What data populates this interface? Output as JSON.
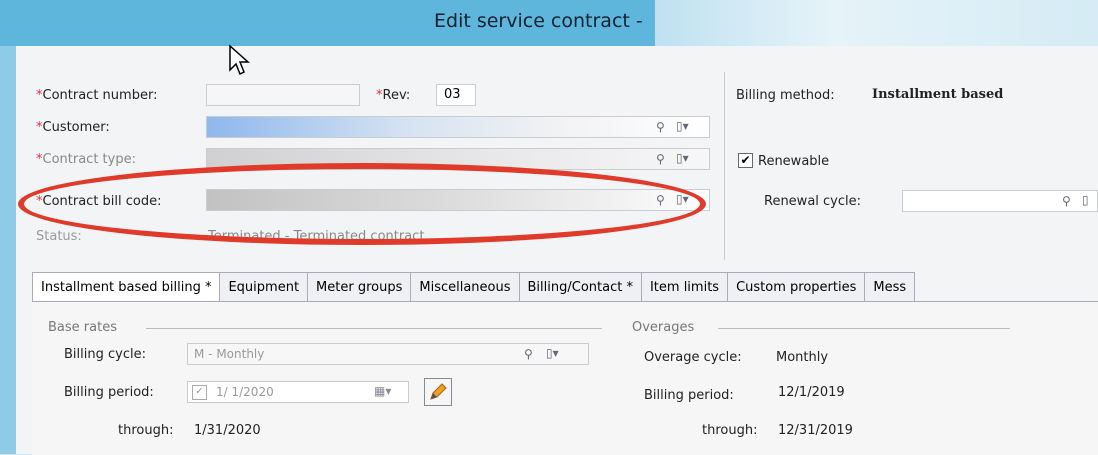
{
  "window": {
    "title": "Edit service contract -"
  },
  "form": {
    "contract_number_label": "Contract number:",
    "rev_label": "Rev:",
    "rev_value": "03",
    "customer_label": "Customer:",
    "contract_type_label": "Contract type:",
    "contract_bill_code_label": "Contract bill code:",
    "status_label": "Status:",
    "status_value": "Terminated - Terminated contract",
    "required_mark": "*"
  },
  "right_panel": {
    "billing_method_label": "Billing method:",
    "billing_method_value": "Installment based",
    "renewable_label": "Renewable",
    "renewable_checked": true,
    "renewal_cycle_label": "Renewal cycle:"
  },
  "tabs": [
    "Installment based billing *",
    "Equipment",
    "Meter groups",
    "Miscellaneous",
    "Billing/Contact *",
    "Item limits",
    "Custom properties",
    "Mess"
  ],
  "base_rates": {
    "section_label": "Base rates",
    "billing_cycle_label": "Billing cycle:",
    "billing_cycle_value": "M - Monthly",
    "billing_period_label": "Billing period:",
    "billing_period_value": "1/ 1/2020",
    "through_label": "through:",
    "through_value": "1/31/2020"
  },
  "overages": {
    "section_label": "Overages",
    "overage_cycle_label": "Overage cycle:",
    "overage_cycle_value": "Monthly",
    "billing_period_label": "Billing period:",
    "billing_period_value": "12/1/2019",
    "through_label": "through:",
    "through_value": "12/31/2019"
  },
  "icons": {
    "search": "search-icon",
    "lookup": "lookup-icon",
    "calendar": "calendar-icon",
    "edit": "pencil-icon",
    "cursor": "mouse-cursor-icon"
  },
  "colors": {
    "highlight": "#e03a2a",
    "title_bar": "#5fb6dc",
    "required": "#dd3333"
  }
}
